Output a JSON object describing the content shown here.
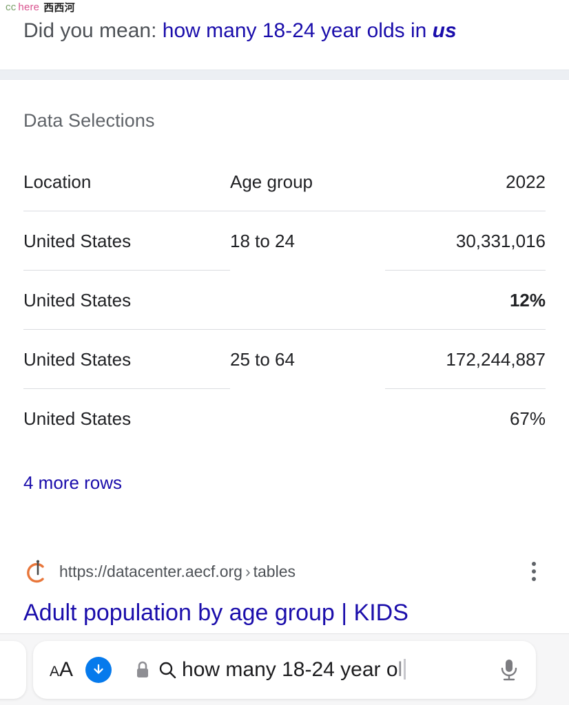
{
  "watermark": {
    "cc": "cc",
    "here": "here",
    "cn": "西西河"
  },
  "did_you_mean": {
    "label": "Did you mean:",
    "suggestion_prefix": "how many 18-24 year olds in ",
    "suggestion_emphasis": "us"
  },
  "data_selections": {
    "title": "Data Selections",
    "columns": [
      "Location",
      "Age group",
      "2022"
    ],
    "rows": [
      {
        "location": "United States",
        "age_group": "18 to 24",
        "value": "30,331,016",
        "bold": false
      },
      {
        "location": "United States",
        "age_group": "",
        "value": "12%",
        "bold": true
      },
      {
        "location": "United States",
        "age_group": "25 to 64",
        "value": "172,244,887",
        "bold": false
      },
      {
        "location": "United States",
        "age_group": "",
        "value": "67%",
        "bold": false
      }
    ],
    "more_rows_label": "4 more rows"
  },
  "result": {
    "favicon_name": "aecf-crescent-favicon",
    "url_domain": "https://datacenter.aecf.org",
    "url_separator": "›",
    "url_path": "tables",
    "title": "Adult population by age group | KIDS",
    "menu_icon": "kebab-menu-icon"
  },
  "browser": {
    "page_settings_small": "A",
    "page_settings_big": "A",
    "download_icon": "download-arrow-icon",
    "lock_icon": "lock-icon",
    "search_icon": "search-icon",
    "address_value": "how many 18-24 year o",
    "address_value_faded": "l",
    "mic_icon": "microphone-icon"
  },
  "colors": {
    "link": "#1a0dab",
    "text": "#202124",
    "muted": "#5f6368",
    "accent_blue": "#067aec",
    "favicon_orange": "#e8763a",
    "band": "#eceff3"
  }
}
